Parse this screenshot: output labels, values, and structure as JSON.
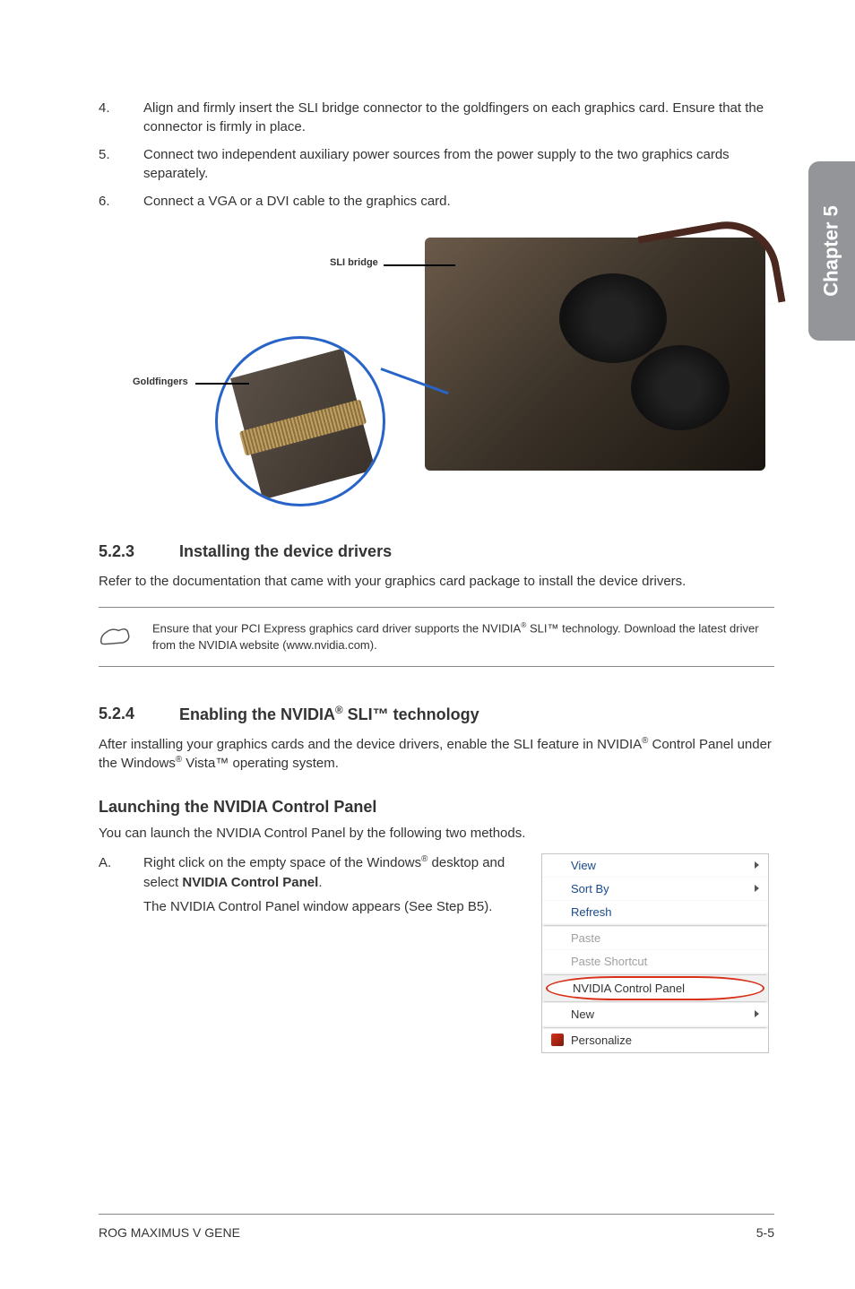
{
  "sideTab": "Chapter 5",
  "steps": [
    {
      "num": "4.",
      "text": "Align and firmly insert the SLI bridge connector to the goldfingers on each graphics card. Ensure that the connector is firmly in place."
    },
    {
      "num": "5.",
      "text": "Connect two independent auxiliary power sources from the power supply to the two graphics cards separately."
    },
    {
      "num": "6.",
      "text": "Connect a VGA or a DVI cable to the graphics card."
    }
  ],
  "diagram": {
    "sliLabel": "SLI bridge",
    "gfLabel": "Goldfingers"
  },
  "section523": {
    "num": "5.2.3",
    "title": "Installing the device drivers",
    "body": "Refer to the documentation that came with your graphics card package to install the device drivers."
  },
  "note": {
    "pre": "Ensure that your PCI Express graphics card driver supports the NVIDIA",
    "sup1": "®",
    "mid": " SLI™ technology. Download the latest driver from the NVIDIA website (www.nvidia.com)."
  },
  "section524": {
    "num": "5.2.4",
    "titlePre": "Enabling the NVIDIA",
    "titleSup": "®",
    "titlePost": " SLI™ technology",
    "body1a": "After installing your graphics cards and the device drivers, enable the SLI feature in NVIDIA",
    "body1sup": "®",
    "body1b": " Control Panel under the Windows",
    "body1sup2": "®",
    "body1c": " Vista™ operating system."
  },
  "launching": {
    "heading": "Launching the NVIDIA Control Panel",
    "intro": "You can launch the NVIDIA Control Panel by the following two methods.",
    "stepLetter": "A.",
    "stepPre": "Right click on the empty space of the Windows",
    "stepSup": "®",
    "stepPost": " desktop and select ",
    "stepBold": "NVIDIA Control Panel",
    "stepEnd": ".",
    "stepSub": "The NVIDIA Control Panel window appears (See Step B5)."
  },
  "menu": {
    "view": "View",
    "sortBy": "Sort By",
    "refresh": "Refresh",
    "paste": "Paste",
    "pasteShortcut": "Paste Shortcut",
    "nvidia": "NVIDIA Control Panel",
    "new": "New",
    "personalize": "Personalize"
  },
  "footer": {
    "left": "ROG MAXIMUS V GENE",
    "right": "5-5"
  }
}
